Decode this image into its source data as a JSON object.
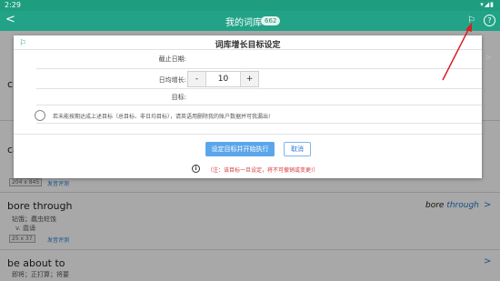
{
  "status": {
    "time": "2:29",
    "sys": "▾◢▮"
  },
  "header": {
    "back": "<",
    "title": "我的词库",
    "count": "662",
    "flag": "⚐",
    "help": "?"
  },
  "list": {
    "items": [
      {
        "word": "cl",
        "meaning": "",
        "sub": ""
      },
      {
        "word": "ca",
        "meaning": "",
        "sub": ""
      },
      {
        "dims": "204 x 845",
        "eval": "发音评测"
      },
      {
        "word": "bore through",
        "meaning": "钻饿；蠢虫蛀蚀",
        "sub": "v. 蠹诵",
        "dims": "25 x 37",
        "eval": "发音评测",
        "right_a": "bore ",
        "right_b": "through"
      },
      {
        "word": "be about to",
        "meaning": "即将；正打算；将要"
      }
    ]
  },
  "dialog": {
    "flag": "⚐",
    "title": "词库增长目标设定",
    "deadline_label": "截止日期:",
    "daily_label": "日均增长:",
    "target_label": "目标:",
    "stepper": {
      "minus": "-",
      "value": "10",
      "plus": "+"
    },
    "chevron": ">",
    "note": "若未能按期达成上述目标（总目标、非日均目标），请英语用删除我的账户数据并可我漏出!",
    "primary_button": "设定目标并开始执行",
    "cancel_button": "取消",
    "warn_icon": "i",
    "warning": "（注：该目标一旦设定，将不可撤销或变更!）"
  },
  "colors": {
    "brand": "#22a387",
    "primary": "#5ba6ea",
    "warning": "#d43b3b",
    "annotation": "#d81f26"
  }
}
